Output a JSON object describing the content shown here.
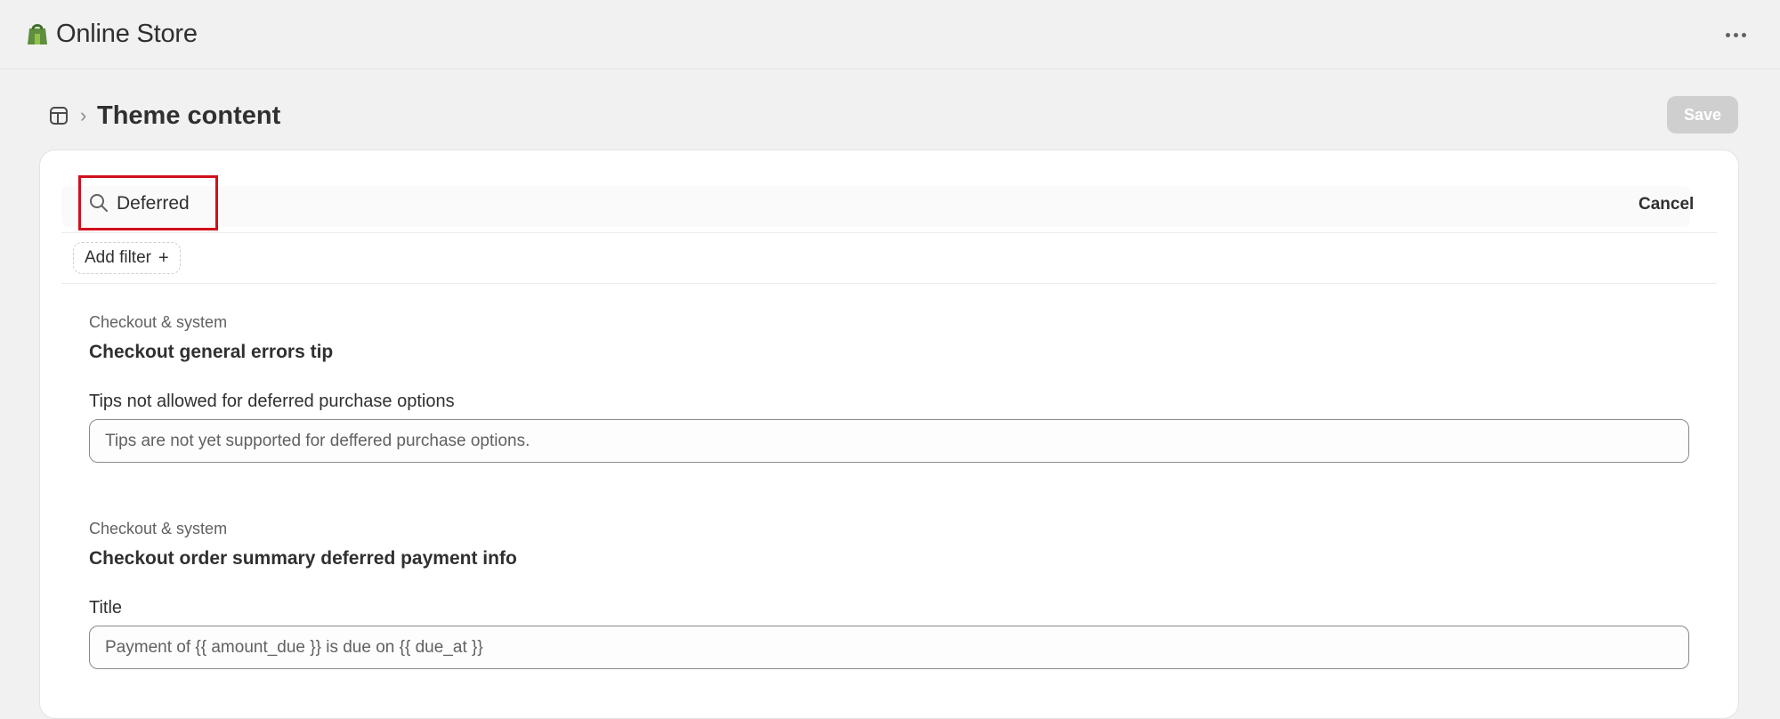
{
  "app": {
    "title": "Online Store",
    "logo_icon": "shopify-bag-icon",
    "more_icon": "ellipsis-horizontal-icon"
  },
  "page": {
    "breadcrumb_icon": "theme-layout-icon",
    "breadcrumb_separator": "›",
    "title": "Theme content",
    "save_label": "Save"
  },
  "search": {
    "value": "Deferred",
    "cancel_label": "Cancel",
    "add_filter_label": "Add filter",
    "add_filter_icon": "+"
  },
  "sections": [
    {
      "category": "Checkout & system",
      "title": "Checkout general errors tip",
      "field_label": "Tips not allowed for deferred purchase options",
      "field_value": "Tips are not yet supported for deffered purchase options."
    },
    {
      "category": "Checkout & system",
      "title": "Checkout order summary deferred payment info",
      "field_label": "Title",
      "field_value": "Payment of {{ amount_due }} is due on {{ due_at }}"
    }
  ],
  "colors": {
    "background": "#f1f1f1",
    "card": "#ffffff",
    "save_disabled": "#cfcfcf",
    "highlight": "#d0101b",
    "logo_green": "#5e8e3e"
  }
}
